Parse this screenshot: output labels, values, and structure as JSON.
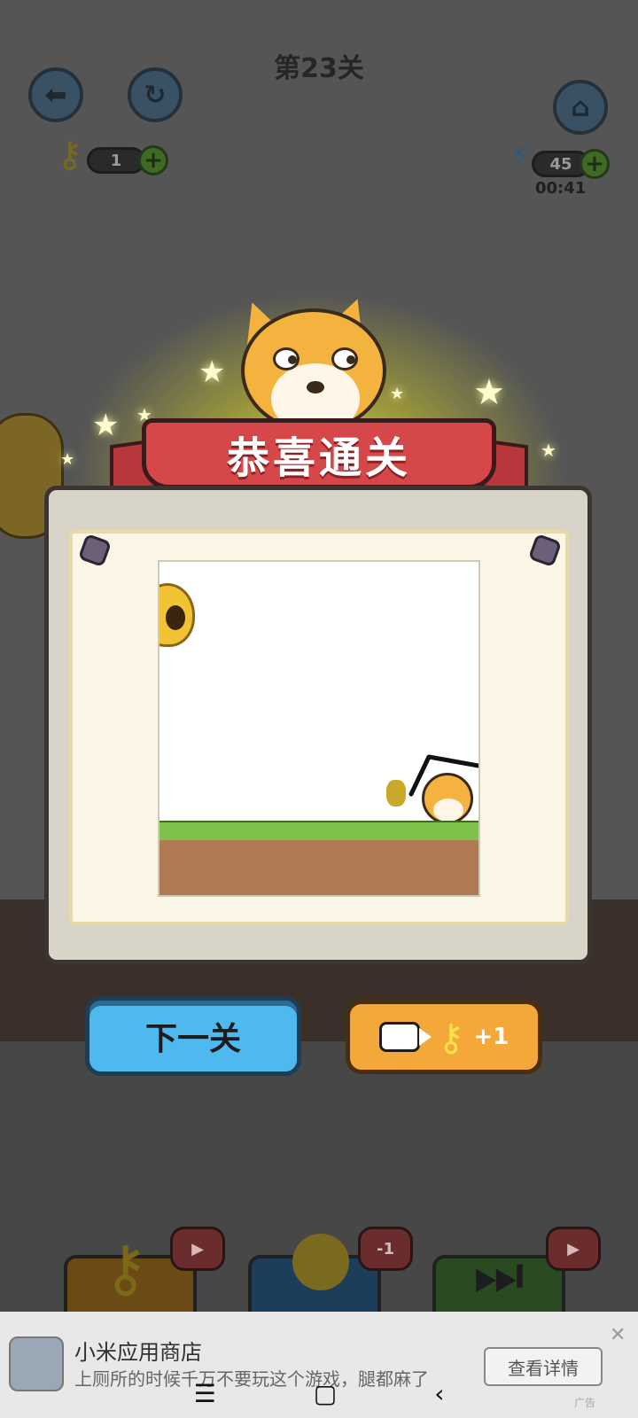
{
  "level": {
    "title": "第23关"
  },
  "hud": {
    "keys_count": "1",
    "energy_count": "45",
    "timer": "00:41"
  },
  "dialog": {
    "banner": "恭喜通关",
    "next_label": "下一关",
    "video_reward": "+1"
  },
  "tools": {
    "hint_badge": "-1"
  },
  "ad": {
    "title": "小米应用商店",
    "desc": "上厕所的时候千万不要玩这个游戏，腿都麻了",
    "cta": "查看详情",
    "tag": "广告"
  },
  "icons": {
    "back": "arrow-left-icon",
    "restart": "restart-icon",
    "home": "home-icon",
    "key": "key-icon",
    "energy": "lightning-icon",
    "video": "video-camera-icon"
  },
  "colors": {
    "banner": "#d6474a",
    "next_button": "#4fb8ef",
    "video_button": "#f4a83a",
    "glow": "#f5f050"
  }
}
